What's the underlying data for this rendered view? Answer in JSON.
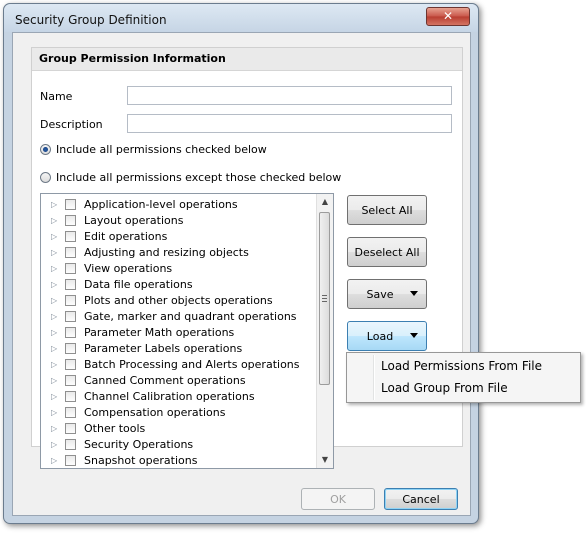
{
  "window": {
    "title": "Security Group Definition",
    "close_glyph": "✕"
  },
  "group": {
    "header": "Group Permission Information",
    "name_label": "Name",
    "name_value": "",
    "description_label": "Description",
    "description_value": "",
    "radio_include": "Include all permissions checked below",
    "radio_exclude": "Include all permissions except those checked below"
  },
  "tree": {
    "items": [
      "Application-level operations",
      "Layout operations",
      "Edit operations",
      "Adjusting and resizing objects",
      "View operations",
      "Data file operations",
      "Plots and other objects operations",
      "Gate, marker and quadrant operations",
      "Parameter Math operations",
      "Parameter Labels operations",
      "Batch Processing and Alerts operations",
      "Canned Comment operations",
      "Channel Calibration operations",
      "Compensation operations",
      "Other tools",
      "Security Operations",
      "Snapshot operations"
    ],
    "expander_glyph": "▷",
    "scroll_up_glyph": "▲",
    "scroll_down_glyph": "▼"
  },
  "buttons": {
    "select_all": "Select All",
    "deselect_all": "Deselect All",
    "save": "Save",
    "load": "Load",
    "ok": "OK",
    "cancel": "Cancel"
  },
  "load_menu": {
    "items": [
      "Load Permissions From File",
      "Load Group From File"
    ]
  }
}
